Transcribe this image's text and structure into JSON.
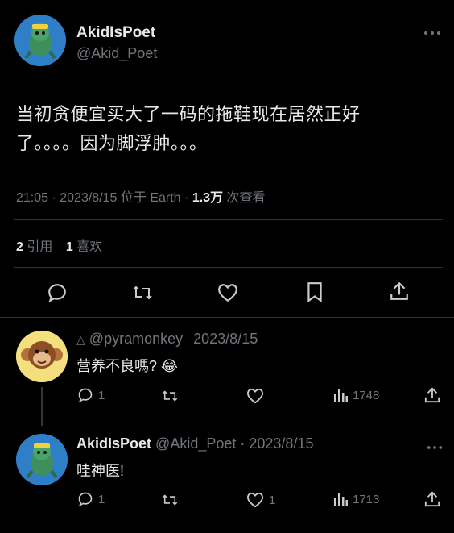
{
  "tweet": {
    "author_name": "AkidIsPoet",
    "author_handle": "@Akid_Poet",
    "text_line1": "当初贪便宜买大了一码的拖鞋现在居然正好",
    "text_line2": "了。。。。因为脚浮肿。。。",
    "meta_time": "21:05 · 2023/8/15 位于 Earth ·",
    "meta_views": "1.3万",
    "meta_views_label": "次查看",
    "quotes_count": "2",
    "quotes_label": "引用",
    "likes_count": "1",
    "likes_label": "喜欢"
  },
  "replies": [
    {
      "author_handle": "@pyramonkey",
      "date": "2023/8/15",
      "text": "营养不良嗎? 😂",
      "reply_count": "1",
      "retweet_count": "",
      "like_count": "",
      "views": "1748"
    },
    {
      "author_name": "AkidIsPoet",
      "author_handle": "@Akid_Poet",
      "date": "· 2023/8/15",
      "text": "哇神医!",
      "reply_count": "1",
      "retweet_count": "",
      "like_count": "1",
      "views": "1713"
    }
  ],
  "icons": {
    "more": "more-horizontal-icon",
    "reply": "reply-icon",
    "retweet": "retweet-icon",
    "like": "heart-icon",
    "bookmark": "bookmark-icon",
    "share": "share-icon",
    "views": "views-bar-chart-icon"
  },
  "colors": {
    "background": "#000000",
    "text": "#e7e9ea",
    "muted": "#71767b",
    "divider": "#2f3336"
  }
}
